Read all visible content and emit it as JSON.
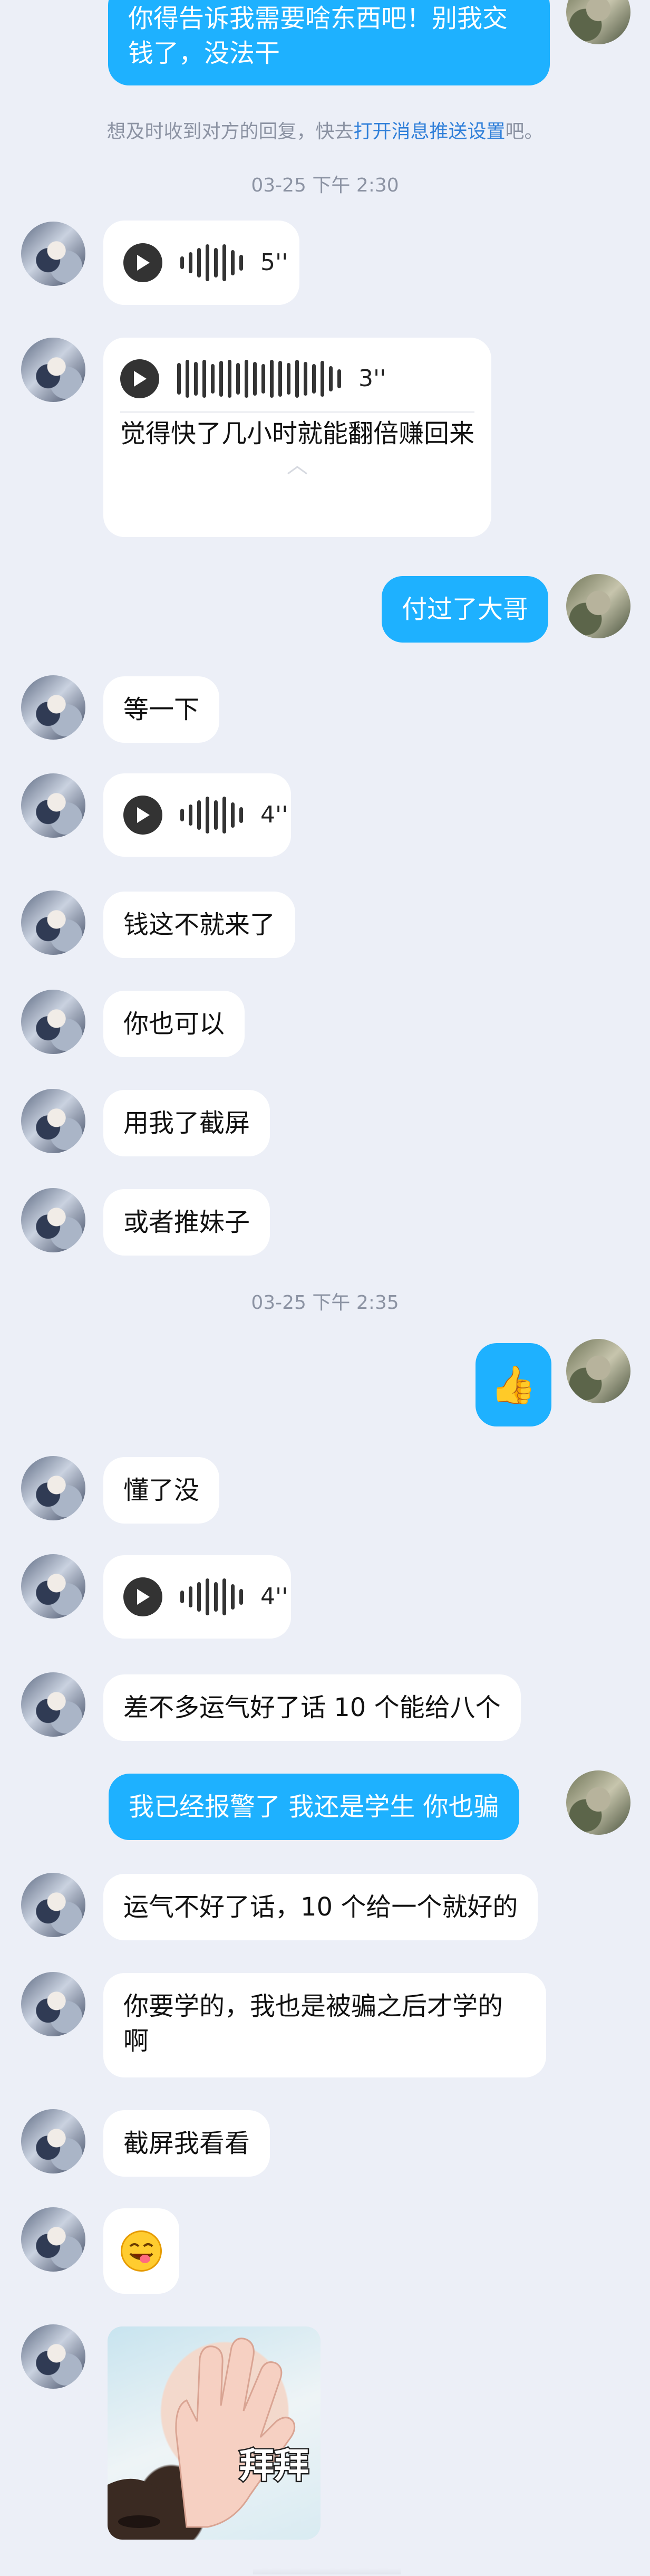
{
  "messages": {
    "m1": "你得告诉我需要啥东西吧！别我交钱了，没法干",
    "notice_pre": "想及时收到对方的回复，快去",
    "notice_link": "打开消息推送设置",
    "notice_post": "吧。",
    "time1": "03-25 下午 2:30",
    "v1_dur": "5''",
    "v2_dur": "3''",
    "v2_transcript": "觉得快了几小时就能翻倍赚回来",
    "m2": "付过了大哥",
    "m3": "等一下",
    "v3_dur": "4''",
    "m4": "钱这不就来了",
    "m5": "你也可以",
    "m6": "用我了截屏",
    "m7": "或者推妹子",
    "time2": "03-25 下午 2:35",
    "thumbs": "👍",
    "m8": "懂了没",
    "v4_dur": "4''",
    "m9": "差不多运气好了话 10 个能给八个",
    "m10": "我已经报警了  我还是学生  你也骗",
    "m11": "运气不好了话，10 个给一个就好的",
    "m12": "你要学的，我也是被骗之后才学的啊",
    "m13": "截屏我看看",
    "sticker_text": "拜拜"
  },
  "colors": {
    "sent": "#1eb1ff",
    "received": "#ffffff",
    "background": "#eceff7"
  },
  "icons": [
    "play-icon",
    "voice-wave-icon",
    "chevron-up-icon",
    "thumbs-up-emoji",
    "tongue-face-emoji"
  ]
}
